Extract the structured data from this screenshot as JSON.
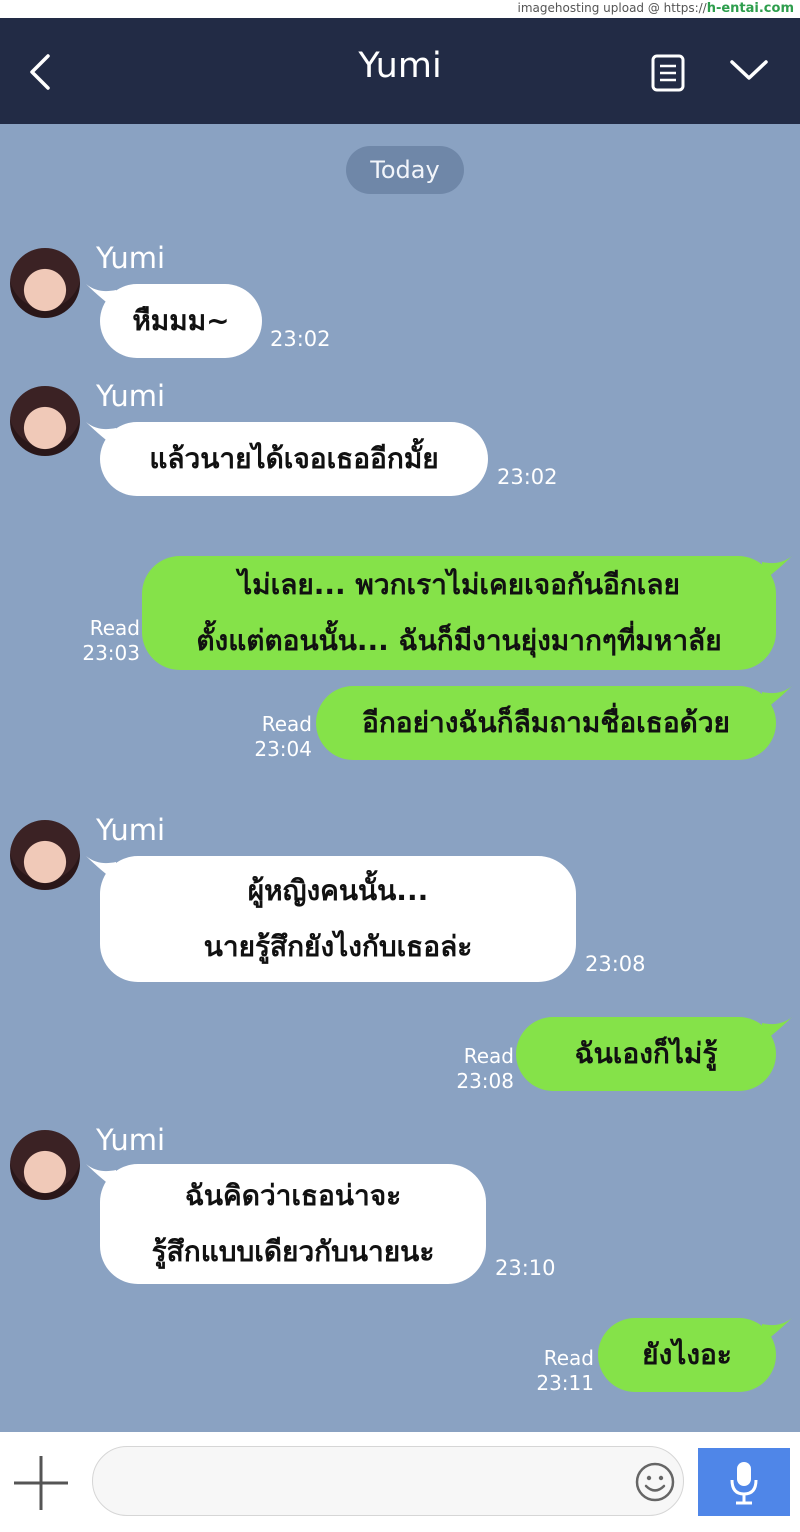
{
  "watermark": {
    "text": "imagehosting upload @ https://",
    "domain": "h-entai.com"
  },
  "header": {
    "title": "Yumi",
    "back_icon": "chevron-left-icon",
    "notes_icon": "notes-icon",
    "menu_icon": "chevron-down-icon",
    "background": "#222b45"
  },
  "chat": {
    "date_chip": "Today",
    "background": "#8aa2c2",
    "messages": [
      {
        "side": "in",
        "sender": "Yumi",
        "lines": [
          "หืมมม~"
        ],
        "time": "23:02"
      },
      {
        "side": "in",
        "sender": "Yumi",
        "lines": [
          "แล้วนายได้เจอเธออีกมั้ย"
        ],
        "time": "23:02"
      },
      {
        "side": "out",
        "lines": [
          "ไม่เลย... พวกเราไม่เคยเจอกันอีกเลย",
          "ตั้งแต่ตอนนั้น... ฉันก็มีงานยุ่งมากๆที่มหาลัย"
        ],
        "read": "Read",
        "time": "23:03"
      },
      {
        "side": "out",
        "lines": [
          "อีกอย่างฉันก็ลืมถามชื่อเธอด้วย"
        ],
        "read": "Read",
        "time": "23:04"
      },
      {
        "side": "in",
        "sender": "Yumi",
        "lines": [
          "ผู้หญิงคนนั้น...",
          "นายรู้สึกยังไงกับเธอล่ะ"
        ],
        "time": "23:08"
      },
      {
        "side": "out",
        "lines": [
          "ฉันเองก็ไม่รู้"
        ],
        "read": "Read",
        "time": "23:08"
      },
      {
        "side": "in",
        "sender": "Yumi",
        "lines": [
          "ฉันคิดว่าเธอน่าจะ",
          "รู้สึกแบบเดียวกับนายนะ"
        ],
        "time": "23:10"
      },
      {
        "side": "out",
        "lines": [
          "ยังไงอะ"
        ],
        "read": "Read",
        "time": "23:11"
      }
    ],
    "incoming_color": "#ffffff",
    "outgoing_color": "#85e249"
  },
  "input_bar": {
    "placeholder": "",
    "plus_icon": "plus-icon",
    "emoji_icon": "smiley-icon",
    "mic_icon": "microphone-icon",
    "mic_color": "#4f86e8"
  }
}
